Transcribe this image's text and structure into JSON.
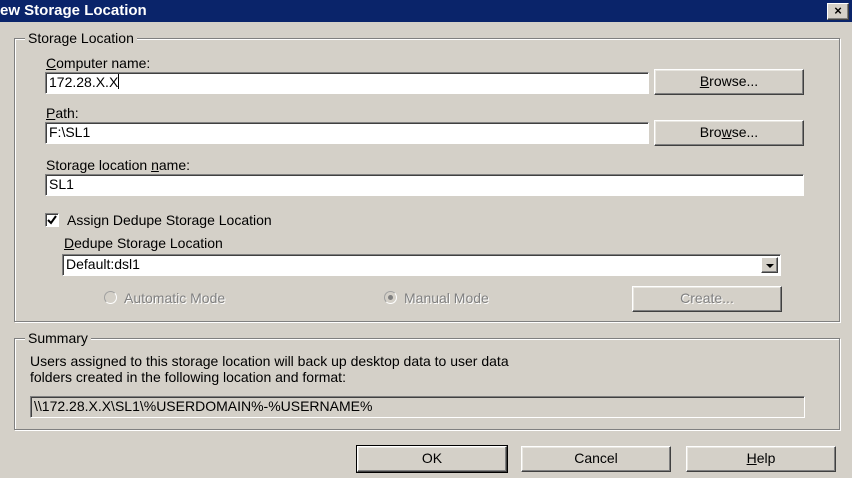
{
  "window": {
    "title": "ew Storage Location",
    "close_glyph": "×"
  },
  "storage_group": {
    "label": "Storage Location",
    "computer_name": {
      "label_underlined": "C",
      "label_rest": "omputer name:",
      "value": "172.28.X.X",
      "browse_underlined": "B",
      "browse_rest": "rowse..."
    },
    "path": {
      "label_underlined": "P",
      "label_rest": "ath:",
      "value": "F:\\SL1",
      "browse_pre": "Bro",
      "browse_underlined": "w",
      "browse_rest": "se..."
    },
    "location_name": {
      "label_pre": "Storage location ",
      "label_underlined": "n",
      "label_rest": "ame:",
      "value": "SL1"
    },
    "assign_dedupe": {
      "label": "Assign Dedupe Storage Location",
      "checked": true
    },
    "dedupe_location": {
      "label_underlined": "D",
      "label_rest": "edupe Storage Location",
      "selected": "Default:dsl1"
    },
    "modes": {
      "automatic": "Automatic Mode",
      "manual": "Manual Mode",
      "selected": "manual"
    },
    "create_button": "Create..."
  },
  "summary_group": {
    "label": "Summary",
    "text_line1": "Users assigned to this storage location will back up desktop data to user data",
    "text_line2": "folders created in the following location and format:",
    "path_value": "\\\\172.28.X.X\\SL1\\%USERDOMAIN%-%USERNAME%"
  },
  "buttons": {
    "ok": "OK",
    "cancel": "Cancel",
    "help_underlined": "H",
    "help_rest": "elp"
  }
}
